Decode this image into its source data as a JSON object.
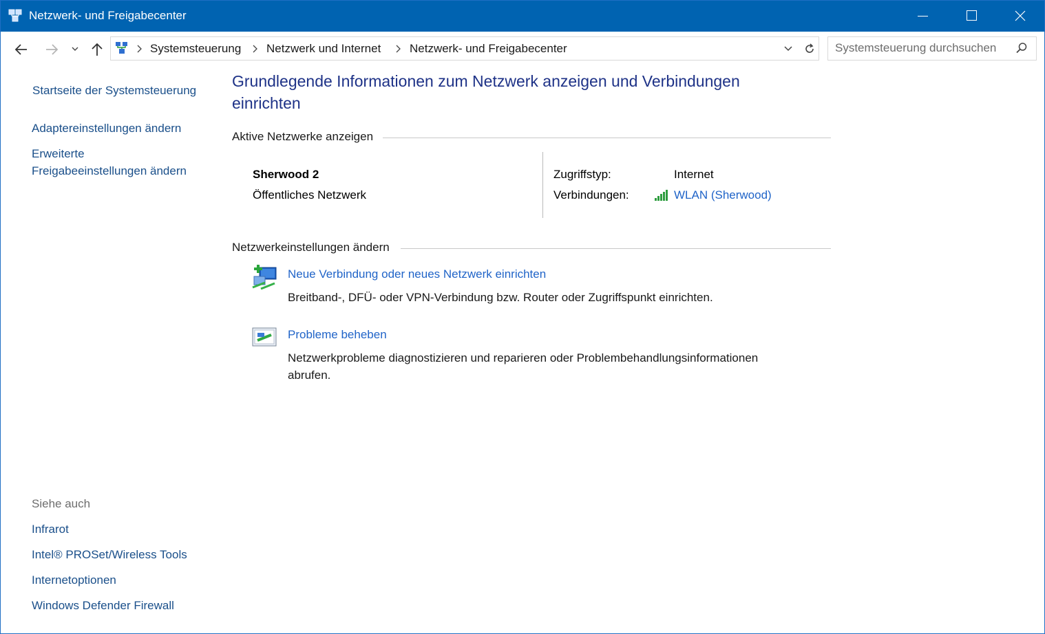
{
  "window": {
    "title": "Netzwerk- und Freigabecenter"
  },
  "navbar": {
    "breadcrumbs": [
      "Systemsteuerung",
      "Netzwerk und Internet",
      "Netzwerk- und Freigabecenter"
    ],
    "search_placeholder": "Systemsteuerung durchsuchen"
  },
  "sidebar": {
    "home_link": "Startseite der Systemsteuerung",
    "links": [
      "Adaptereinstellungen ändern",
      "Erweiterte",
      "Freigabeeinstellungen ändern"
    ],
    "see_also_heading": "Siehe auch",
    "see_also": [
      "Infrarot",
      "Intel® PROSet/Wireless Tools",
      "Internetoptionen",
      "Windows Defender Firewall"
    ]
  },
  "main": {
    "title_line1": "Grundlegende Informationen zum Netzwerk anzeigen und Verbindungen",
    "title_line2": "einrichten",
    "active_heading": "Aktive Netzwerke anzeigen",
    "network": {
      "name": "Sherwood 2",
      "category": "Öffentliches Netzwerk",
      "access_label": "Zugriffstyp:",
      "access_value": "Internet",
      "connections_label": "Verbindungen:",
      "connection_link": "WLAN (Sherwood)"
    },
    "settings_heading": "Netzwerkeinstellungen ändern",
    "tasks": [
      {
        "link": "Neue Verbindung oder neues Netzwerk einrichten",
        "desc1": "Breitband-, DFÜ- oder VPN-Verbindung bzw. Router oder Zugriffspunkt einrichten.",
        "desc2": ""
      },
      {
        "link": "Probleme beheben",
        "desc1": "Netzwerkprobleme diagnostizieren und reparieren oder Problembehandlungsinformationen",
        "desc2": "abrufen."
      }
    ]
  },
  "colors": {
    "titlebar": "#0063b1",
    "title_text": "#1e3287",
    "link": "#2064c8",
    "nav_link": "#1a4f8a"
  },
  "icons": {
    "app": "network-sharing-icon",
    "back": "arrow-left-icon",
    "forward": "arrow-right-icon",
    "recent": "chevron-down-icon",
    "up": "arrow-up-icon",
    "refresh": "refresh-icon",
    "search": "search-icon"
  }
}
